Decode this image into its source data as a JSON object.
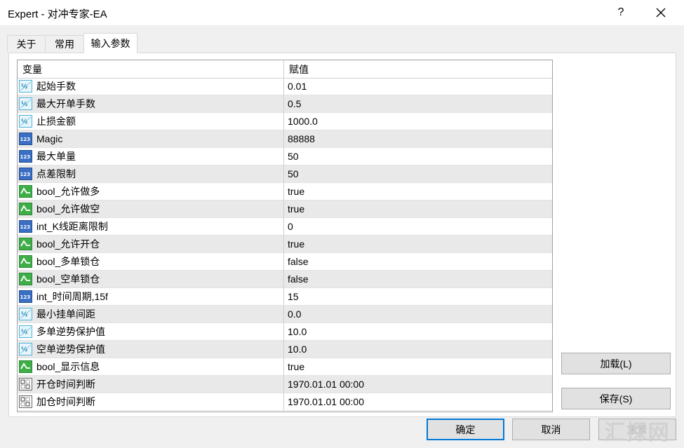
{
  "window": {
    "title": "Expert - 对冲专家-EA",
    "help_label": "?",
    "close_icon": "close-icon"
  },
  "tabs": [
    {
      "label": "关于",
      "active": false
    },
    {
      "label": "常用",
      "active": false
    },
    {
      "label": "输入参数",
      "active": true
    }
  ],
  "grid": {
    "columns": {
      "variable": "变量",
      "value": "赋值"
    },
    "rows": [
      {
        "icon": "double-icon",
        "name": "起始手数",
        "value": "0.01"
      },
      {
        "icon": "double-icon",
        "name": "最大开单手数",
        "value": "0.5"
      },
      {
        "icon": "double-icon",
        "name": "止损金额",
        "value": "1000.0"
      },
      {
        "icon": "int-icon",
        "name": "Magic",
        "value": "88888"
      },
      {
        "icon": "int-icon",
        "name": "最大单量",
        "value": "50"
      },
      {
        "icon": "int-icon",
        "name": "点差限制",
        "value": "50"
      },
      {
        "icon": "bool-icon",
        "name": "bool_允许做多",
        "value": "true"
      },
      {
        "icon": "bool-icon",
        "name": "bool_允许做空",
        "value": "true"
      },
      {
        "icon": "int-icon",
        "name": "int_K线距离限制",
        "value": "0"
      },
      {
        "icon": "bool-icon",
        "name": "bool_允许开仓",
        "value": "true"
      },
      {
        "icon": "bool-icon",
        "name": "bool_多单锁仓",
        "value": "false"
      },
      {
        "icon": "bool-icon",
        "name": "bool_空单锁仓",
        "value": "false"
      },
      {
        "icon": "int-icon",
        "name": "int_时间周期,15f",
        "value": "15"
      },
      {
        "icon": "double-icon",
        "name": "最小挂单间距",
        "value": "0.0"
      },
      {
        "icon": "double-icon",
        "name": "多单逆势保护值",
        "value": "10.0"
      },
      {
        "icon": "double-icon",
        "name": "空单逆势保护值",
        "value": "10.0"
      },
      {
        "icon": "bool-icon",
        "name": "bool_显示信息",
        "value": "true"
      },
      {
        "icon": "datetime-icon",
        "name": "开仓时间判断",
        "value": "1970.01.01 00:00"
      },
      {
        "icon": "datetime-icon",
        "name": "加仓时间判断",
        "value": "1970.01.01 00:00"
      }
    ]
  },
  "buttons": {
    "load": "加载(L)",
    "save": "保存(S)",
    "ok": "确定",
    "cancel": "取消",
    "reset": "重置"
  },
  "watermark": "汇探网",
  "colors": {
    "accent": "#0078d7",
    "row_alt": "#e9e9e9",
    "double_icon": "#4fb3d9",
    "int_icon": "#3a6fc4",
    "bool_icon": "#3fae49"
  }
}
